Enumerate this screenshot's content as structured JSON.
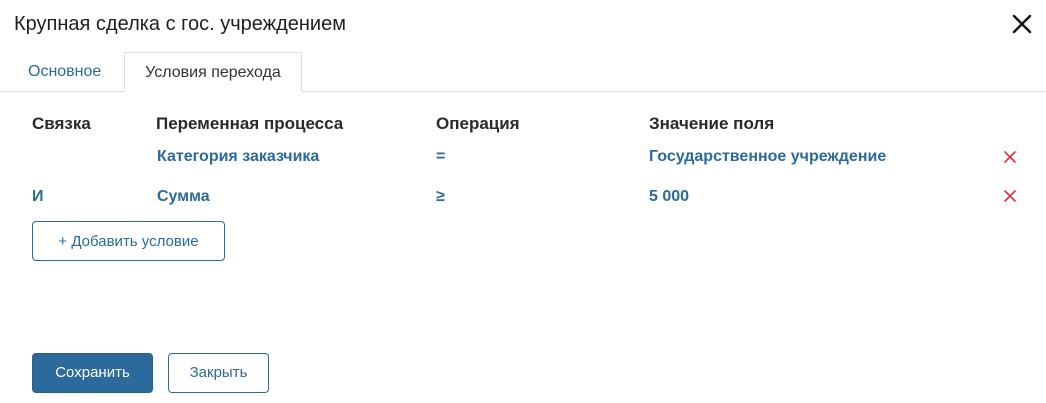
{
  "dialog": {
    "title": "Крупная сделка с гос. учреждением",
    "close_icon": "close-icon"
  },
  "tabs": [
    {
      "label": "Основное",
      "active": false
    },
    {
      "label": "Условия перехода",
      "active": true
    }
  ],
  "conditions": {
    "headers": {
      "link": "Связка",
      "variable": "Переменная процесса",
      "operation": "Операция",
      "value": "Значение поля"
    },
    "rows": [
      {
        "link": "",
        "variable": "Категория заказчика",
        "operation": "=",
        "value": "Государственное учреждение",
        "remove_icon": "remove-icon"
      },
      {
        "link": "И",
        "variable": "Сумма",
        "operation": "≥",
        "value": "5 000",
        "remove_icon": "remove-icon"
      }
    ],
    "add_label": "+ Добавить условие"
  },
  "footer": {
    "save_label": "Сохранить",
    "close_label": "Закрыть"
  },
  "colors": {
    "accent": "#2b6a9b",
    "remove": "#e0303a",
    "text": "#222222"
  }
}
